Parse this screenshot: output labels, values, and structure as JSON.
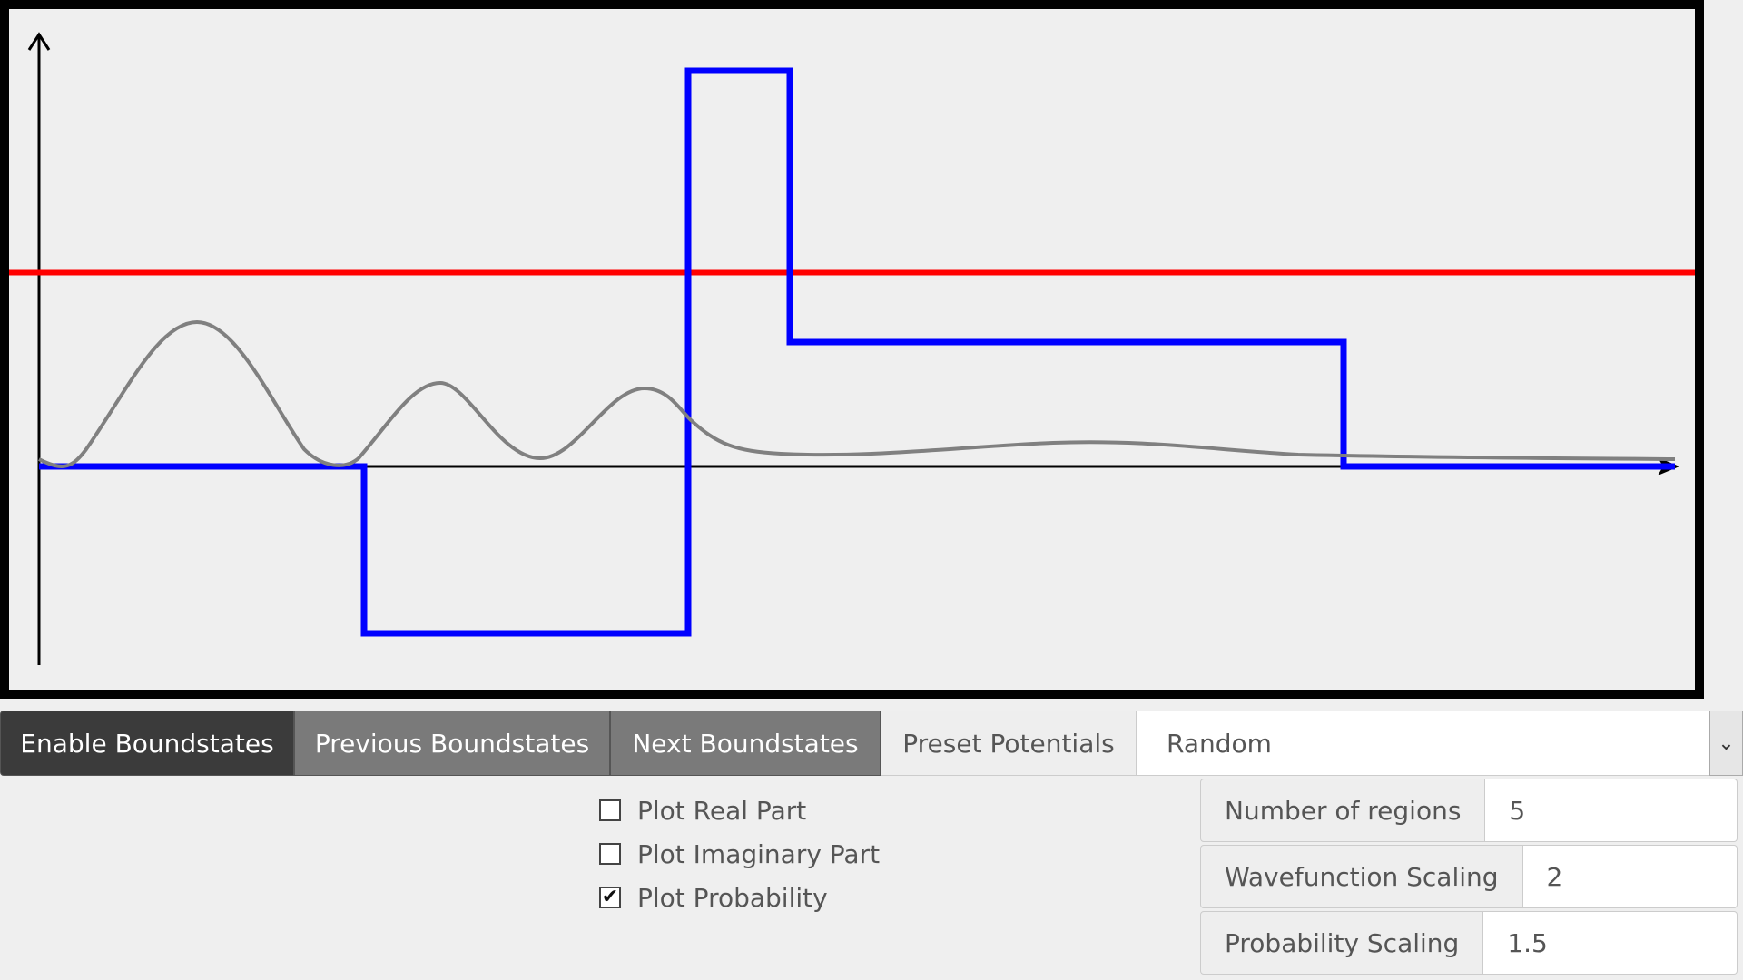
{
  "toolbar": {
    "enable_label": "Enable Boundstates",
    "prev_label": "Previous Boundstates",
    "next_label": "Next Boundstates",
    "preset_label": "Preset Potentials",
    "preset_value": "Random"
  },
  "checkboxes": [
    {
      "label": "Plot Real Part",
      "checked": false
    },
    {
      "label": "Plot Imaginary Part",
      "checked": false
    },
    {
      "label": "Plot Probability",
      "checked": true
    }
  ],
  "inputs": [
    {
      "label": "Number of regions",
      "value": "5"
    },
    {
      "label": "Wavefunction Scaling",
      "value": "2"
    },
    {
      "label": "Probability Scaling",
      "value": "1.5"
    }
  ],
  "colors": {
    "potential": "#0000ff",
    "energy": "#ff0000",
    "probability": "#808080",
    "axes": "#000000"
  }
}
